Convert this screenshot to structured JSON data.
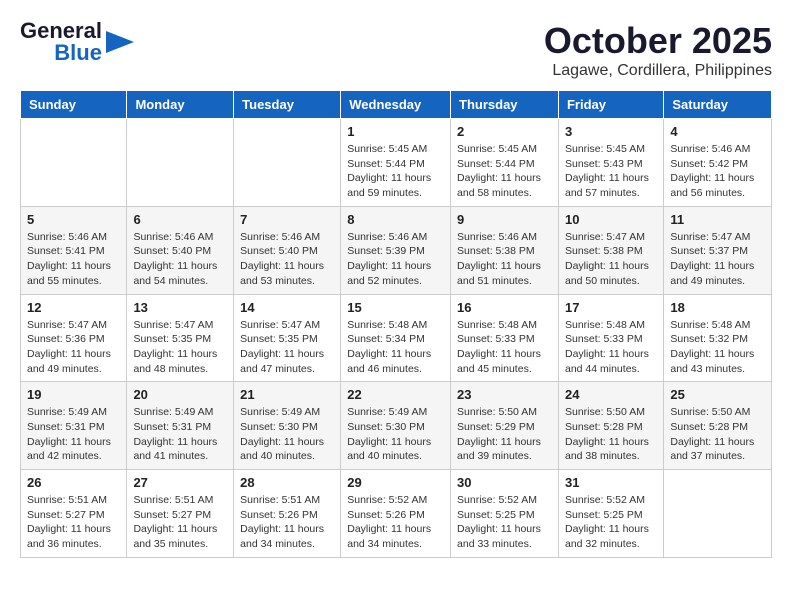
{
  "logo": {
    "line1": "General",
    "line2": "Blue"
  },
  "title": "October 2025",
  "location": "Lagawe, Cordillera, Philippines",
  "weekdays": [
    "Sunday",
    "Monday",
    "Tuesday",
    "Wednesday",
    "Thursday",
    "Friday",
    "Saturday"
  ],
  "weeks": [
    [
      {
        "day": "",
        "info": ""
      },
      {
        "day": "",
        "info": ""
      },
      {
        "day": "",
        "info": ""
      },
      {
        "day": "1",
        "info": "Sunrise: 5:45 AM\nSunset: 5:44 PM\nDaylight: 11 hours\nand 59 minutes."
      },
      {
        "day": "2",
        "info": "Sunrise: 5:45 AM\nSunset: 5:44 PM\nDaylight: 11 hours\nand 58 minutes."
      },
      {
        "day": "3",
        "info": "Sunrise: 5:45 AM\nSunset: 5:43 PM\nDaylight: 11 hours\nand 57 minutes."
      },
      {
        "day": "4",
        "info": "Sunrise: 5:46 AM\nSunset: 5:42 PM\nDaylight: 11 hours\nand 56 minutes."
      }
    ],
    [
      {
        "day": "5",
        "info": "Sunrise: 5:46 AM\nSunset: 5:41 PM\nDaylight: 11 hours\nand 55 minutes."
      },
      {
        "day": "6",
        "info": "Sunrise: 5:46 AM\nSunset: 5:40 PM\nDaylight: 11 hours\nand 54 minutes."
      },
      {
        "day": "7",
        "info": "Sunrise: 5:46 AM\nSunset: 5:40 PM\nDaylight: 11 hours\nand 53 minutes."
      },
      {
        "day": "8",
        "info": "Sunrise: 5:46 AM\nSunset: 5:39 PM\nDaylight: 11 hours\nand 52 minutes."
      },
      {
        "day": "9",
        "info": "Sunrise: 5:46 AM\nSunset: 5:38 PM\nDaylight: 11 hours\nand 51 minutes."
      },
      {
        "day": "10",
        "info": "Sunrise: 5:47 AM\nSunset: 5:38 PM\nDaylight: 11 hours\nand 50 minutes."
      },
      {
        "day": "11",
        "info": "Sunrise: 5:47 AM\nSunset: 5:37 PM\nDaylight: 11 hours\nand 49 minutes."
      }
    ],
    [
      {
        "day": "12",
        "info": "Sunrise: 5:47 AM\nSunset: 5:36 PM\nDaylight: 11 hours\nand 49 minutes."
      },
      {
        "day": "13",
        "info": "Sunrise: 5:47 AM\nSunset: 5:35 PM\nDaylight: 11 hours\nand 48 minutes."
      },
      {
        "day": "14",
        "info": "Sunrise: 5:47 AM\nSunset: 5:35 PM\nDaylight: 11 hours\nand 47 minutes."
      },
      {
        "day": "15",
        "info": "Sunrise: 5:48 AM\nSunset: 5:34 PM\nDaylight: 11 hours\nand 46 minutes."
      },
      {
        "day": "16",
        "info": "Sunrise: 5:48 AM\nSunset: 5:33 PM\nDaylight: 11 hours\nand 45 minutes."
      },
      {
        "day": "17",
        "info": "Sunrise: 5:48 AM\nSunset: 5:33 PM\nDaylight: 11 hours\nand 44 minutes."
      },
      {
        "day": "18",
        "info": "Sunrise: 5:48 AM\nSunset: 5:32 PM\nDaylight: 11 hours\nand 43 minutes."
      }
    ],
    [
      {
        "day": "19",
        "info": "Sunrise: 5:49 AM\nSunset: 5:31 PM\nDaylight: 11 hours\nand 42 minutes."
      },
      {
        "day": "20",
        "info": "Sunrise: 5:49 AM\nSunset: 5:31 PM\nDaylight: 11 hours\nand 41 minutes."
      },
      {
        "day": "21",
        "info": "Sunrise: 5:49 AM\nSunset: 5:30 PM\nDaylight: 11 hours\nand 40 minutes."
      },
      {
        "day": "22",
        "info": "Sunrise: 5:49 AM\nSunset: 5:30 PM\nDaylight: 11 hours\nand 40 minutes."
      },
      {
        "day": "23",
        "info": "Sunrise: 5:50 AM\nSunset: 5:29 PM\nDaylight: 11 hours\nand 39 minutes."
      },
      {
        "day": "24",
        "info": "Sunrise: 5:50 AM\nSunset: 5:28 PM\nDaylight: 11 hours\nand 38 minutes."
      },
      {
        "day": "25",
        "info": "Sunrise: 5:50 AM\nSunset: 5:28 PM\nDaylight: 11 hours\nand 37 minutes."
      }
    ],
    [
      {
        "day": "26",
        "info": "Sunrise: 5:51 AM\nSunset: 5:27 PM\nDaylight: 11 hours\nand 36 minutes."
      },
      {
        "day": "27",
        "info": "Sunrise: 5:51 AM\nSunset: 5:27 PM\nDaylight: 11 hours\nand 35 minutes."
      },
      {
        "day": "28",
        "info": "Sunrise: 5:51 AM\nSunset: 5:26 PM\nDaylight: 11 hours\nand 34 minutes."
      },
      {
        "day": "29",
        "info": "Sunrise: 5:52 AM\nSunset: 5:26 PM\nDaylight: 11 hours\nand 34 minutes."
      },
      {
        "day": "30",
        "info": "Sunrise: 5:52 AM\nSunset: 5:25 PM\nDaylight: 11 hours\nand 33 minutes."
      },
      {
        "day": "31",
        "info": "Sunrise: 5:52 AM\nSunset: 5:25 PM\nDaylight: 11 hours\nand 32 minutes."
      },
      {
        "day": "",
        "info": ""
      }
    ]
  ]
}
